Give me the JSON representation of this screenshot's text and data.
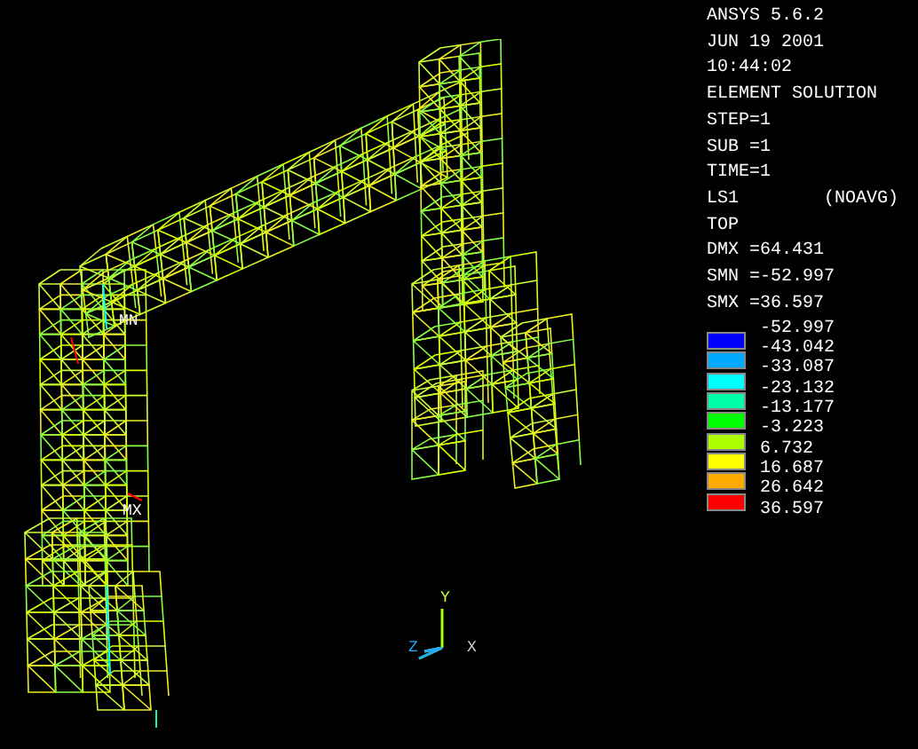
{
  "info_lines": [
    "ANSYS 5.6.2",
    "JUN 19 2001",
    "10:44:02",
    "ELEMENT SOLUTION",
    "STEP=1",
    "SUB =1",
    "TIME=1",
    "LS1        (NOAVG)",
    "TOP",
    "DMX =64.431",
    "SMN =-52.997",
    "SMX =36.597"
  ],
  "legend": [
    {
      "value": "-52.997"
    },
    {
      "value": "-43.042",
      "color": "#0000ff"
    },
    {
      "value": "-33.087",
      "color": "#00aaff"
    },
    {
      "value": "-23.132",
      "color": "#00ffff"
    },
    {
      "value": "-13.177",
      "color": "#00ffaa"
    },
    {
      "value": "-3.223",
      "color": "#00ff00"
    },
    {
      "value": "6.732",
      "color": "#aaff00"
    },
    {
      "value": "16.687",
      "color": "#ffff00"
    },
    {
      "value": "26.642",
      "color": "#ffaa00"
    },
    {
      "value": "36.597",
      "color": "#ff0000"
    }
  ],
  "markers": {
    "min": "MN",
    "max": "MX"
  },
  "triad": {
    "y": "Y",
    "z": "Z",
    "x": "X"
  }
}
